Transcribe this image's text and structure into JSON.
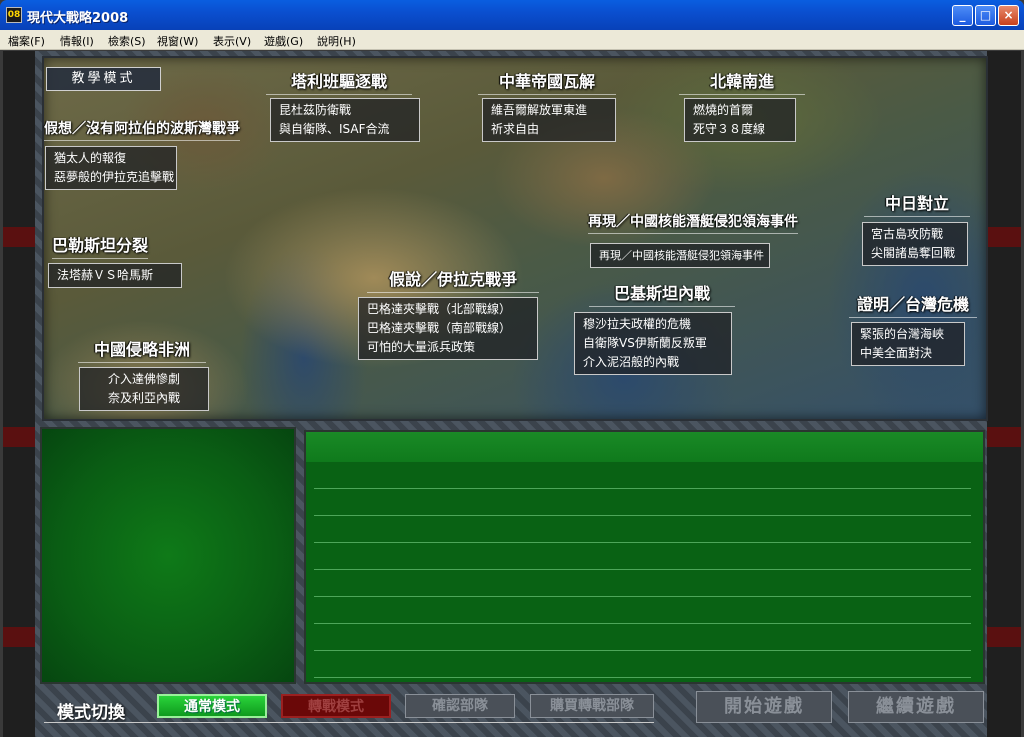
{
  "window": {
    "title": "現代大戰略2008",
    "icon_text": "08",
    "min": "_",
    "max": "□",
    "close": "×"
  },
  "menu": [
    {
      "label": "檔案(F)"
    },
    {
      "label": "情報(I)"
    },
    {
      "label": "檢索(S)"
    },
    {
      "label": "視窗(W)"
    },
    {
      "label": "表示(V)"
    },
    {
      "label": "遊戲(G)"
    },
    {
      "label": "說明(H)"
    }
  ],
  "tutorial": "教學模式",
  "scenarios": {
    "taliban": {
      "title": "塔利班驅逐戰",
      "lines": [
        "昆杜茲防衛戰",
        "與自衛隊、ISAF合流"
      ]
    },
    "china": {
      "title": "中華帝國瓦解",
      "lines": [
        "維吾爾解放軍東進",
        "祈求自由"
      ]
    },
    "korea": {
      "title": "北韓南進",
      "lines": [
        "燃燒的首爾",
        "死守３８度線"
      ]
    },
    "gulf": {
      "title": "假想／沒有阿拉伯的波斯灣戰爭",
      "lines": [
        "猶太人的報復",
        "惡夢般的伊拉克追擊戰"
      ]
    },
    "palestine": {
      "title": "巴勒斯坦分裂",
      "lines": [
        "法塔赫ＶＳ哈馬斯"
      ]
    },
    "iraq": {
      "title": "假說／伊拉克戰爭",
      "lines": [
        "巴格達夾擊戰（北部戰線）",
        "巴格達夾擊戰（南部戰線）",
        "可怕的大量派兵政策"
      ]
    },
    "submarine": {
      "title": "再現／中國核能潛艇侵犯領海事件",
      "lines": [
        "再現／中國核能潛艇侵犯領海事件"
      ]
    },
    "pakistan": {
      "title": "巴基斯坦內戰",
      "lines": [
        "穆沙拉夫政權的危機",
        "自衛隊VS伊斯蘭反叛軍",
        "介入泥沼般的內戰"
      ]
    },
    "japan": {
      "title": "中日對立",
      "lines": [
        "宮古島攻防戰",
        "尖閣諸島奪回戰"
      ]
    },
    "taiwan": {
      "title": "證明／台灣危機",
      "lines": [
        "緊張的台灣海峽",
        "中美全面對決"
      ]
    },
    "africa": {
      "title": "中國侵略非洲",
      "lines": [
        "介入達佛慘劇",
        "奈及利亞內戰"
      ]
    }
  },
  "bottom": {
    "mode_label": "模式切換",
    "normal": "通常模式",
    "switch": "轉戰模式",
    "confirm": "確認部隊",
    "buy": "購買轉戰部隊",
    "start": "開始遊戲",
    "continue": "繼續遊戲"
  }
}
